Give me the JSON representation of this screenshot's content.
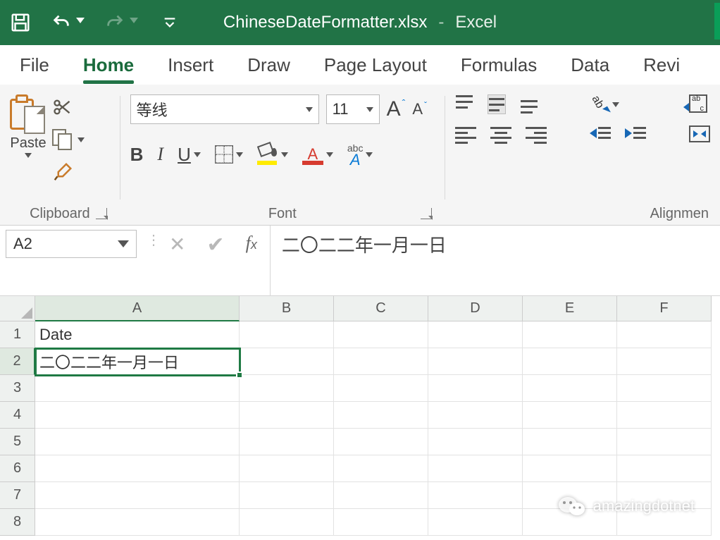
{
  "title": {
    "filename": "ChineseDateFormatter.xlsx",
    "separator": "-",
    "app": "Excel"
  },
  "tabs": [
    "File",
    "Home",
    "Insert",
    "Draw",
    "Page Layout",
    "Formulas",
    "Data",
    "Revi"
  ],
  "active_tab": "Home",
  "ribbon": {
    "clipboard": {
      "paste": "Paste",
      "label": "Clipboard"
    },
    "font": {
      "name": "等线",
      "size": "11",
      "label": "Font"
    },
    "alignment": {
      "label": "Alignmen"
    }
  },
  "namebox": "A2",
  "formula": "二〇二二年一月一日",
  "columns": [
    "A",
    "B",
    "C",
    "D",
    "E",
    "F"
  ],
  "row_headers": [
    "1",
    "2",
    "3",
    "4",
    "5",
    "6",
    "7",
    "8"
  ],
  "cells": {
    "A1": "Date",
    "A2": "二〇二二年一月一日"
  },
  "selected_cell": "A2",
  "watermark": "amazingdotnet"
}
